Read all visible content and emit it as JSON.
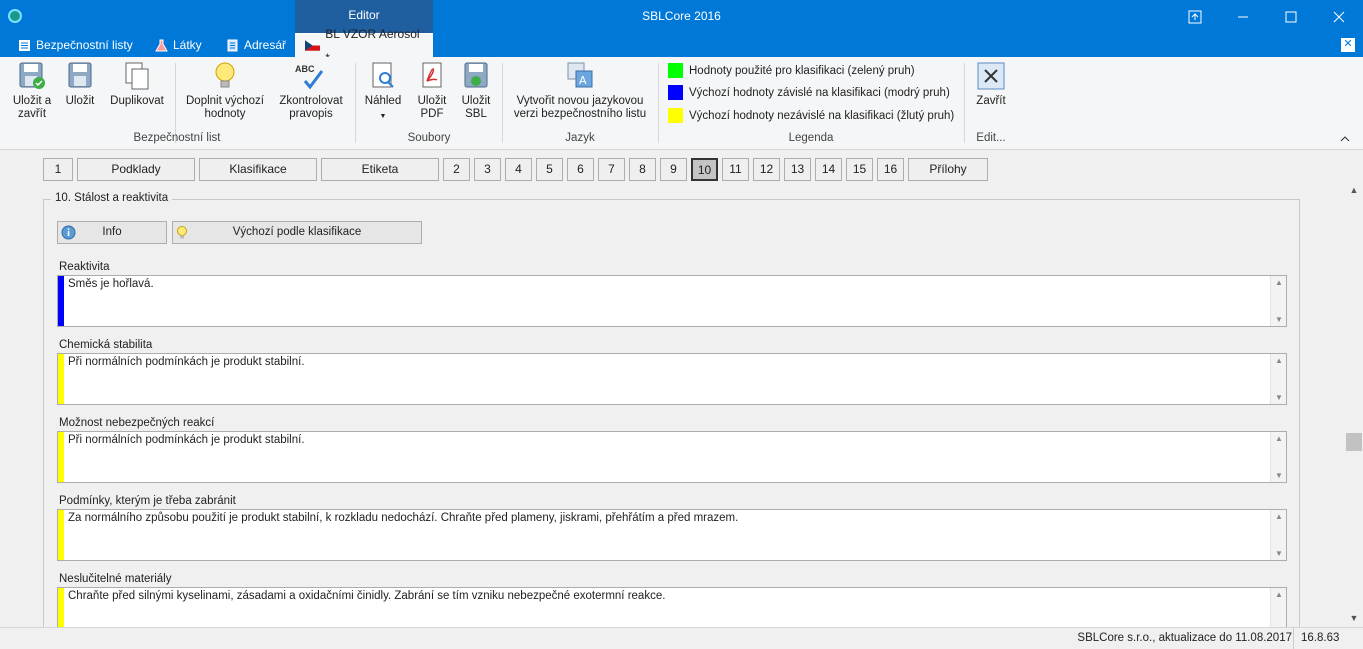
{
  "window": {
    "title": "SBLCore 2016",
    "editor_context_tab": "Editor"
  },
  "tabs": [
    {
      "label": "Bezpečnostní listy"
    },
    {
      "label": "Látky"
    },
    {
      "label": "Adresář"
    },
    {
      "label": "BL VZOR Aerosol *"
    }
  ],
  "ribbon": {
    "groups": {
      "bezpecnostni_list": {
        "label": "Bezpečnostní list",
        "buttons": [
          "Uložit a\nzavřít",
          "Uložit",
          "Duplikovat",
          "Doplnit výchozí\nhodnoty",
          "Zkontrolovat\npravopis"
        ]
      },
      "soubory": {
        "label": "Soubory",
        "buttons": [
          "Náhled",
          "Uložit\nPDF",
          "Uložit\nSBL"
        ]
      },
      "jazyk": {
        "label": "Jazyk",
        "buttons": [
          "Vytvořit novou jazykovou\nverzi bezpečnostního listu"
        ]
      },
      "legenda": {
        "label": "Legenda",
        "items": [
          {
            "label": "Hodnoty použité pro klasifikaci (zelený pruh)",
            "color": "#00ff00"
          },
          {
            "label": "Výchozí hodnoty závislé na klasifikaci (modrý pruh)",
            "color": "#0000ff"
          },
          {
            "label": "Výchozí hodnoty nezávislé na klasifikaci (žlutý pruh)",
            "color": "#ffff00"
          }
        ]
      },
      "edit": {
        "label": "Edit...",
        "buttons": [
          "Zavřít"
        ]
      }
    },
    "spellcheck_icon_text": "ABC"
  },
  "section_nav": [
    "1",
    "Podklady",
    "Klasifikace",
    "Etiketa",
    "2",
    "3",
    "4",
    "5",
    "6",
    "7",
    "8",
    "9",
    "10",
    "11",
    "12",
    "13",
    "14",
    "15",
    "16",
    "Přílohy"
  ],
  "active_section": "10",
  "section": {
    "title": "10. Stálost a reaktivita",
    "info_button": "Info",
    "default_button": "Výchozí podle klasifikace",
    "fields": [
      {
        "label": "Reaktivita",
        "value": "Směs je hořlavá.",
        "bar_color": "#0000ff"
      },
      {
        "label": "Chemická stabilita",
        "value": "Při normálních podmínkách je produkt stabilní.",
        "bar_color": "#ffff00"
      },
      {
        "label": "Možnost nebezpečných reakcí",
        "value": "Při normálních podmínkách je produkt stabilní.",
        "bar_color": "#ffff00"
      },
      {
        "label": "Podmínky, kterým je třeba zabránit",
        "value": "Za normálního způsobu použití je produkt stabilní, k rozkladu nedochází. Chraňte před plameny, jiskrami, přehřátím a před mrazem.",
        "bar_color": "#ffff00"
      },
      {
        "label": "Neslučitelné materiály",
        "value": "Chraňte před silnými kyselinami, zásadami a oxidačními činidly. Zabrání se tím vzniku nebezpečné exotermní reakce.",
        "bar_color": "#ffff00"
      }
    ]
  },
  "status": {
    "company": "SBLCore s.r.o., aktualizace do 11.08.2017",
    "version": "16.8.63"
  }
}
